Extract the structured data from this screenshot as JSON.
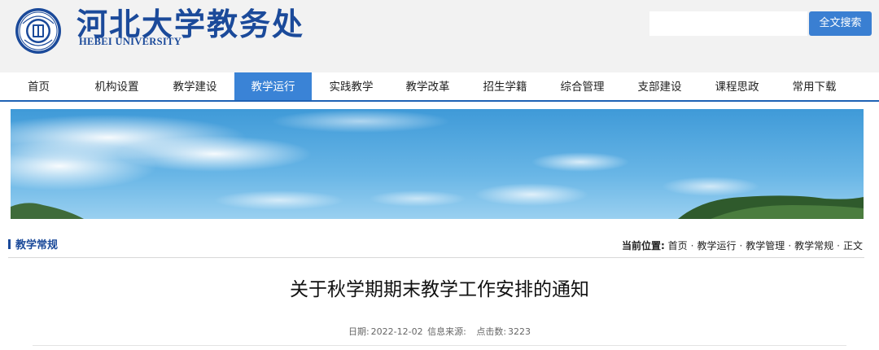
{
  "header": {
    "logo_cn": "河北大学教务处",
    "logo_en": "HEBEI UNIVERSITY",
    "search": {
      "value": "",
      "placeholder": "",
      "button_label": "全文搜索"
    }
  },
  "nav": {
    "active_index": 3,
    "items": [
      {
        "label": "首页"
      },
      {
        "label": "机构设置"
      },
      {
        "label": "教学建设"
      },
      {
        "label": "教学运行"
      },
      {
        "label": "实践教学"
      },
      {
        "label": "教学改革"
      },
      {
        "label": "招生学籍"
      },
      {
        "label": "综合管理"
      },
      {
        "label": "支部建设"
      },
      {
        "label": "课程思政"
      },
      {
        "label": "常用下载"
      }
    ]
  },
  "section": {
    "title": "教学常规",
    "breadcrumb_label": "当前位置:",
    "breadcrumb": [
      "首页",
      "教学运行",
      "教学管理",
      "教学常规",
      "正文"
    ]
  },
  "article": {
    "title": "关于秋学期期末教学工作安排的通知",
    "date_label": "日期:",
    "date": "2022-12-02",
    "source_label": "信息来源:",
    "source": "",
    "clicks_label": "点击数:",
    "clicks": "3223"
  },
  "colors": {
    "brand_blue": "#1b4a9a",
    "nav_active": "#3a83d6",
    "search_button": "#3a7fd2",
    "header_bg": "#f2f2f2"
  }
}
